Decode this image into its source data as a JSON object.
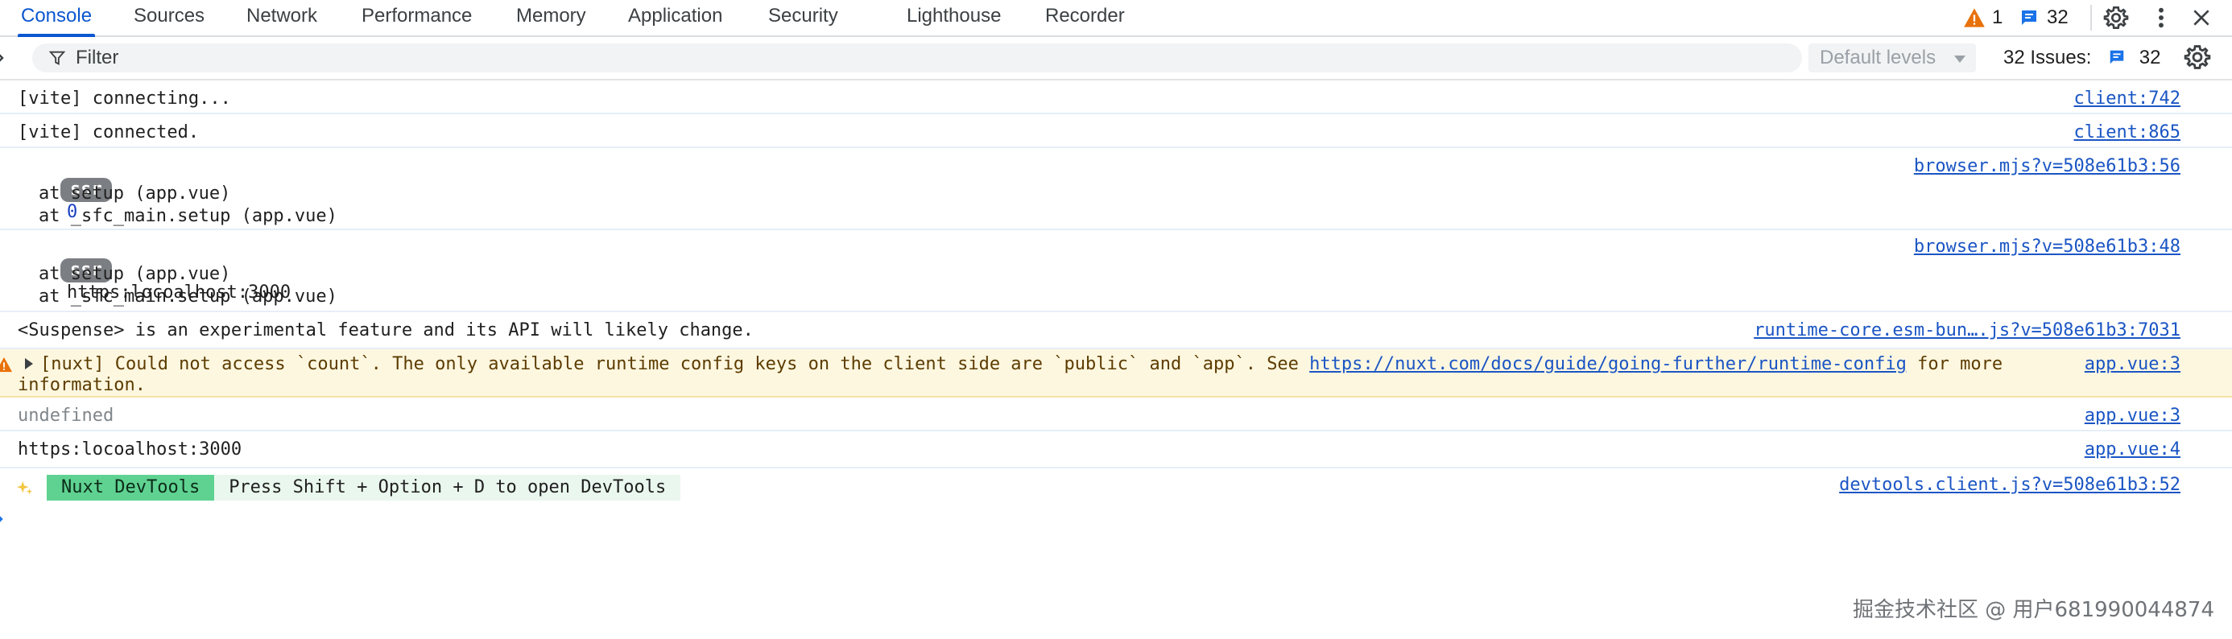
{
  "tabs": [
    {
      "label": "Console"
    },
    {
      "label": "Sources"
    },
    {
      "label": "Network"
    },
    {
      "label": "Performance"
    },
    {
      "label": "Memory"
    },
    {
      "label": "Application"
    },
    {
      "label": "Security"
    },
    {
      "label": "Lighthouse"
    },
    {
      "label": "Recorder"
    }
  ],
  "toolbar": {
    "warning_count": "1",
    "message_count": "32"
  },
  "filterbar": {
    "filter_placeholder": "Filter",
    "levels_label": "Default levels",
    "issues_label": "32 Issues:",
    "issues_count": "32"
  },
  "messages": [
    {
      "text": "[vite] connecting...",
      "source": "client:742"
    },
    {
      "text": "[vite] connected.",
      "source": "client:865"
    },
    {
      "badge": "ssr",
      "value": "0",
      "stack": [
        "at setup (app.vue)",
        "at _sfc_main.setup (app.vue)"
      ],
      "source": "browser.mjs?v=508e61b3:56"
    },
    {
      "badge": "ssr",
      "value": "https:locoalhost:3000",
      "stack": [
        "at setup (app.vue)",
        "at _sfc_main.setup (app.vue)"
      ],
      "source": "browser.mjs?v=508e61b3:48"
    },
    {
      "text": "<Suspense> is an experimental feature and its API will likely change.",
      "source": "runtime-core.esm-bun….js?v=508e61b3:7031"
    },
    {
      "level": "warning",
      "text_before": "[nuxt] Could not access `count`. The only available runtime config keys on the client side are `public` and `app`. See ",
      "link": "https://nuxt.com/docs/guide/going-further/runtime-config",
      "text_after": " for more",
      "text_line2": "information.",
      "source": "app.vue:3"
    },
    {
      "text": "undefined",
      "source": "app.vue:3"
    },
    {
      "text": "https:locoalhost:3000",
      "source": "app.vue:4"
    },
    {
      "tag": "Nuxt DevTools",
      "hint": "Press Shift + Option + D to open DevTools",
      "source": "devtools.client.js?v=508e61b3:52"
    }
  ],
  "watermark": "掘金技术社区 @ 用户681990044874",
  "colors": {
    "accent": "#0b57d0",
    "warning": "#e8710a",
    "link": "#1a55c4",
    "nuxt_green": "#5fd291"
  }
}
